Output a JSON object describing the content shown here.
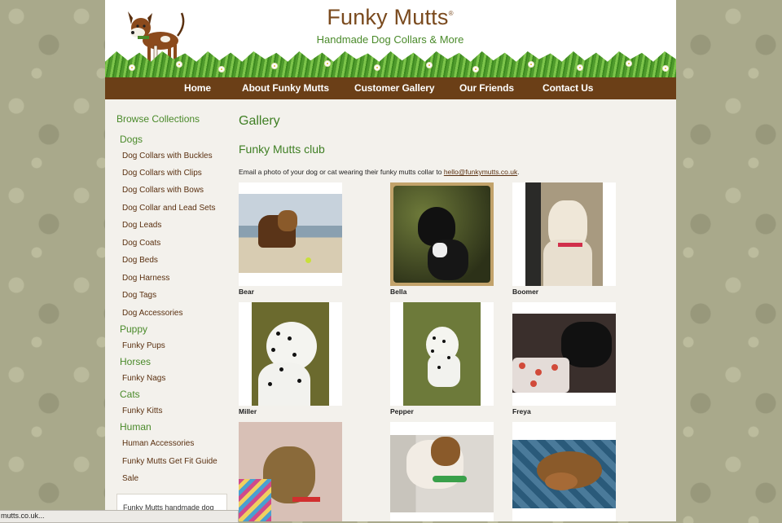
{
  "brand": {
    "title": "Funky Mutts",
    "reg_mark": "®",
    "tagline": "Handmade Dog Collars & More"
  },
  "nav": [
    "Home",
    "About Funky Mutts",
    "Customer Gallery",
    "Our Friends",
    "Contact Us"
  ],
  "sidebar": {
    "heading": "Browse Collections",
    "groups": [
      {
        "label": "Dogs",
        "items": [
          "Dog Collars with Buckles",
          "Dog Collars with Clips",
          "Dog Collars with Bows",
          "Dog Collar and Lead Sets",
          "Dog Leads",
          "Dog Coats",
          "Dog Beds",
          "Dog Harness",
          "Dog Tags",
          "Dog Accessories"
        ]
      },
      {
        "label": "Puppy",
        "items": [
          "Funky Pups"
        ]
      },
      {
        "label": "Horses",
        "items": [
          "Funky Nags"
        ]
      },
      {
        "label": "Cats",
        "items": [
          "Funky Kitts"
        ]
      },
      {
        "label": "Human",
        "items": [
          "Human Accessories",
          "Funky Mutts Get Fit Guide",
          "Sale"
        ]
      }
    ],
    "box_text": "Funky Mutts handmade dog"
  },
  "main": {
    "title": "Gallery",
    "subtitle": "Funky Mutts club",
    "intro_text": "Email a photo of your dog or cat wearing their funky mutts collar to ",
    "email": "hello@funkymutts.co.uk",
    "intro_end": ".",
    "gallery": [
      {
        "name": "Bear"
      },
      {
        "name": "Bella"
      },
      {
        "name": "Boomer"
      },
      {
        "name": "Miller"
      },
      {
        "name": "Pepper"
      },
      {
        "name": "Freya"
      },
      {
        "name": ""
      },
      {
        "name": ""
      },
      {
        "name": ""
      }
    ]
  },
  "status_bar": "mutts.co.uk...",
  "colors": {
    "brown": "#6b3f17",
    "green": "#4a8a2a",
    "title_brown": "#7a4a1e"
  }
}
